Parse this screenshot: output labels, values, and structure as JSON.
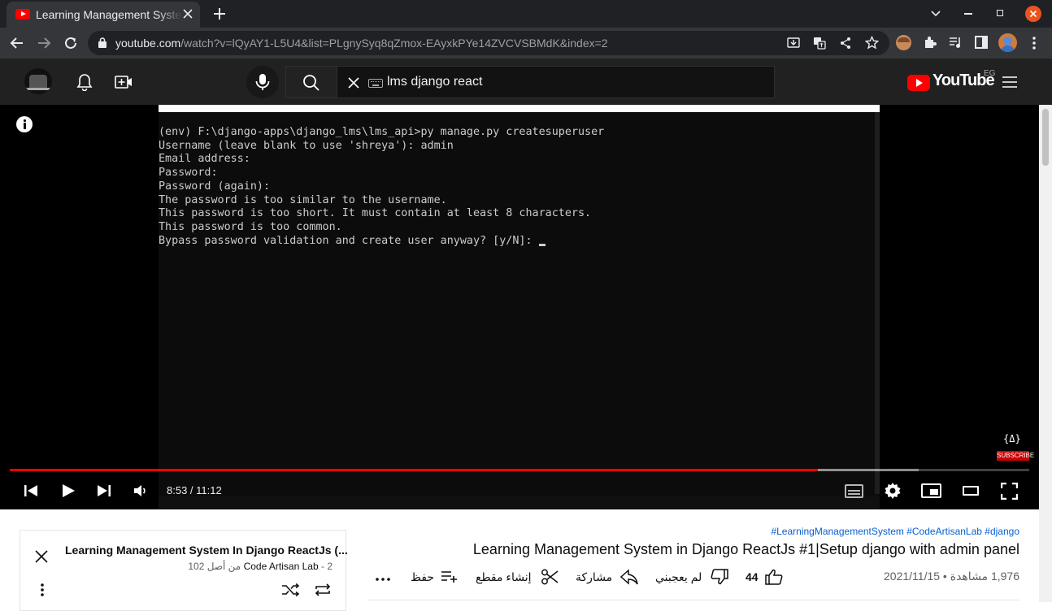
{
  "browser": {
    "tab_title": "Learning Management System In Django ReactJs",
    "url_host": "youtube.com",
    "url_rest": "/watch?v=lQyAY1-L5U4&list=PLgnySyq8qZmox-EAyxkPYe14ZVCVSBMdK&index=2"
  },
  "youtube": {
    "search_query": "lms django react",
    "logo_text": "YouTube",
    "region": "EG"
  },
  "terminal": {
    "lines": [
      "(env) F:\\django-apps\\django_lms\\lms_api>py manage.py createsuperuser",
      "Username (leave blank to use 'shreya'): admin",
      "Email address:",
      "Password:",
      "Password (again):",
      "The password is too similar to the username.",
      "This password is too short. It must contain at least 8 characters.",
      "This password is too common.",
      "Bypass password validation and create user anyway? [y/N]: "
    ]
  },
  "player": {
    "time": "8:53 / 11:12",
    "progress": 0.7924,
    "buffered": 0.8915,
    "subscribe_badge": "SUBSCRIBE"
  },
  "playlist": {
    "title": "Learning Management System In Django ReactJs (...",
    "channel": "Code Artisan Lab",
    "position": "2 من أصل 102"
  },
  "video": {
    "hashtags": "#LearningManagementSystem #CodeArtisanLab #django",
    "title": "Learning Management System in Django ReactJs #1|Setup django with admin panel",
    "views": "1,976 مشاهدة",
    "date": "2021/11/15",
    "likes": "44",
    "dislike_label": "لم يعجبني",
    "share_label": "مشاركة",
    "clip_label": "إنشاء مقطع",
    "save_label": "حفظ"
  }
}
